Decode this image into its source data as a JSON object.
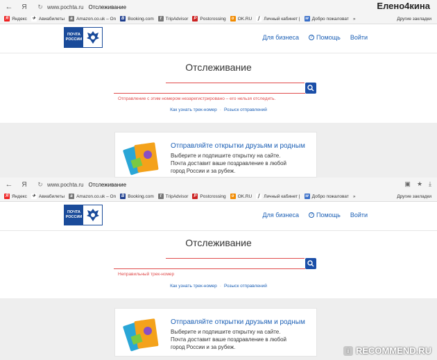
{
  "watermark_user": "Елено4кина",
  "browser": {
    "url": "www.pochta.ru",
    "tab_title": "Отслеживание",
    "ya_label": "Я",
    "bookmarks": [
      {
        "label": "Яндекс",
        "icon": "yandex-icon",
        "color": "#e22"
      },
      {
        "label": "Авиабилеты",
        "icon": "plane-icon",
        "color": "#444"
      },
      {
        "label": "Amazon.co.uk – Оn",
        "icon": "amazon-icon",
        "color": "#777"
      },
      {
        "label": "Booking.com",
        "icon": "booking-icon",
        "color": "#1e3e8e"
      },
      {
        "label": "TripAdvisor",
        "icon": "tripadvisor-icon",
        "color": "#777"
      },
      {
        "label": "Postcrossing",
        "icon": "postcrossing-icon",
        "color": "#c22"
      },
      {
        "label": "OK.RU",
        "icon": "ok-icon",
        "color": "#f28b00"
      },
      {
        "label": "Личный кабинет |",
        "icon": "cabinet-icon",
        "color": "#444"
      },
      {
        "label": "Добро пожаловат",
        "icon": "welcome-icon",
        "color": "#3a6fc8"
      }
    ],
    "more": "»",
    "other_bookmarks": "Другие закладки"
  },
  "site": {
    "logo_line1": "ПОЧТА",
    "logo_line2": "РОССИИ",
    "nav_business": "Для бизнеса",
    "nav_help": "Помощь",
    "nav_login": "Войти",
    "track_title": "Отслеживание",
    "link_know": "Как узнать трек-номер",
    "link_search": "Розыск отправлений",
    "promo_title": "Отправляйте открытки друзьям и родным",
    "promo_line1": "Выберите и подпишите открытку на сайте.",
    "promo_line2": "Почта доставит ваше поздравление в любой",
    "promo_line3": "город России и за рубеж."
  },
  "shot1": {
    "error": "Отправление с этим номером незарегистрировано – его нельзя отследить."
  },
  "shot2": {
    "error": "Неправильный трек-номер"
  },
  "badge": "RECOMMEND.RU"
}
